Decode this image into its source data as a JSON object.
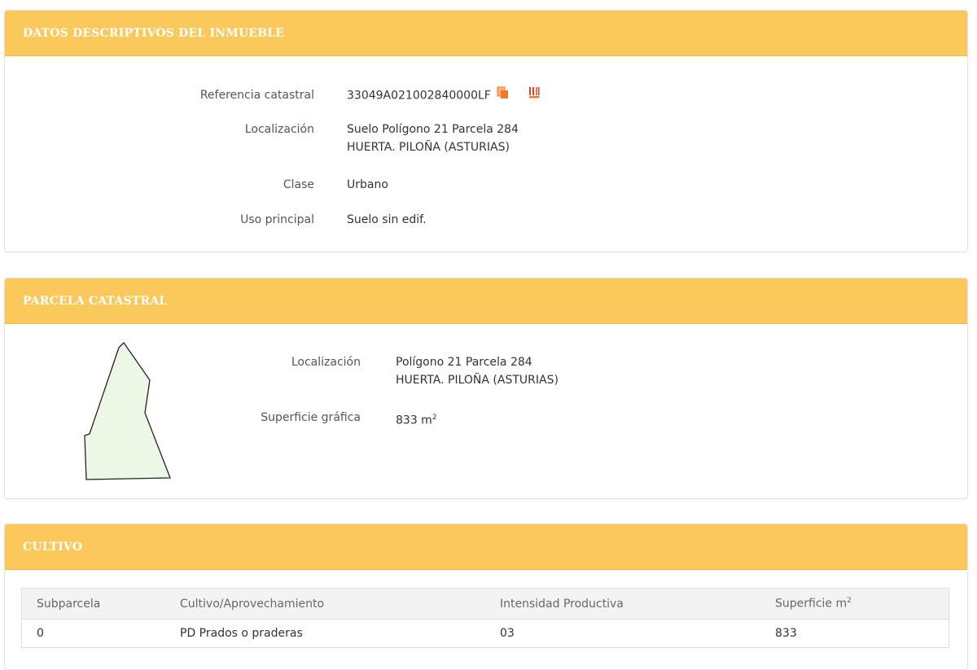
{
  "datos": {
    "title": "DATOS DESCRIPTIVOS DEL INMUEBLE",
    "rows": [
      {
        "label": "Referencia catastral",
        "value": "33049A021002840000LF"
      },
      {
        "label": "Localización",
        "value": "Suelo Polígono 21 Parcela 284",
        "value2": "HUERTA. PILOÑA (ASTURIAS)"
      },
      {
        "label": "Clase",
        "value": "Urbano"
      },
      {
        "label": "Uso principal",
        "value": "Suelo sin edif."
      }
    ],
    "icons": [
      "copy-icon",
      "barcode-icon"
    ]
  },
  "parcela": {
    "title": "PARCELA CATASTRAL",
    "rows": [
      {
        "label": "Localización",
        "value": "Polígono 21 Parcela 284",
        "value2": "HUERTA. PILOÑA (ASTURIAS)"
      },
      {
        "label": "Superficie gráfica",
        "value": "833 m",
        "sup": "2"
      }
    ],
    "map_fill": "#edf7e6"
  },
  "cultivo": {
    "title": "CULTIVO",
    "columns": [
      "Subparcela",
      "Cultivo/Aprovechamiento",
      "Intensidad Productiva",
      "Superficie m"
    ],
    "columns_sup": "2",
    "rows": [
      [
        "0",
        "PD Prados o praderas",
        "03",
        "833"
      ]
    ]
  },
  "colors": {
    "header_bg": "#fbc85b",
    "header_text": "#ffffff",
    "icon_orange": "#f07a2a",
    "icon_red": "#e23b2a"
  }
}
